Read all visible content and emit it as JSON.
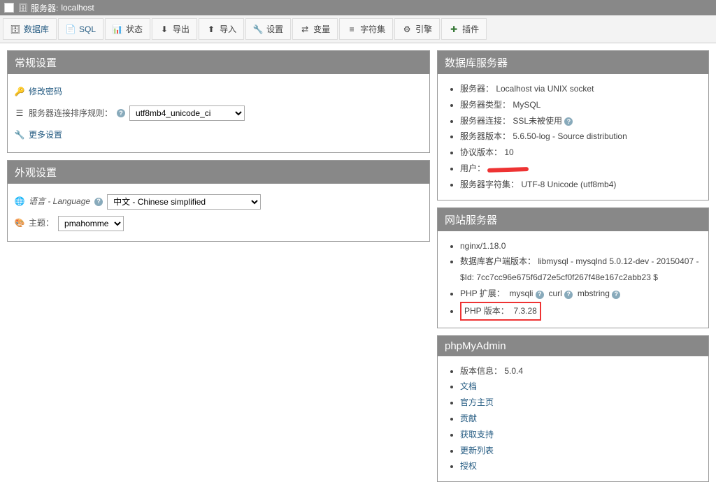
{
  "topbar": {
    "server_prefix": "服务器:",
    "server_name": "localhost"
  },
  "toolbar": {
    "items": [
      {
        "label": "数据库",
        "icon": "database-icon",
        "color": "#235a81"
      },
      {
        "label": "SQL",
        "icon": "sql-icon",
        "color": "#235a81"
      },
      {
        "label": "状态",
        "icon": "status-icon",
        "color": "#444"
      },
      {
        "label": "导出",
        "icon": "export-icon",
        "color": "#444"
      },
      {
        "label": "导入",
        "icon": "import-icon",
        "color": "#444"
      },
      {
        "label": "设置",
        "icon": "settings-icon",
        "color": "#444"
      },
      {
        "label": "变量",
        "icon": "variables-icon",
        "color": "#444"
      },
      {
        "label": "字符集",
        "icon": "charsets-icon",
        "color": "#444"
      },
      {
        "label": "引擎",
        "icon": "engines-icon",
        "color": "#444"
      },
      {
        "label": "插件",
        "icon": "plugins-icon",
        "color": "#444"
      }
    ]
  },
  "general": {
    "title": "常规设置",
    "change_password": "修改密码",
    "collation_label": "服务器连接排序规则：",
    "collation_value": "utf8mb4_unicode_ci",
    "more_settings": "更多设置"
  },
  "appearance": {
    "title": "外观设置",
    "language_label": "语言 - Language",
    "language_value": "中文 - Chinese simplified",
    "theme_label": "主题：",
    "theme_value": "pmahomme"
  },
  "db_server": {
    "title": "数据库服务器",
    "items": [
      "服务器：  Localhost via UNIX socket",
      "服务器类型：  MySQL",
      "服务器连接：  SSL未被使用",
      "服务器版本：  5.6.50-log - Source distribution",
      "协议版本：  10",
      "用户：",
      "服务器字符集：  UTF-8 Unicode (utf8mb4)"
    ]
  },
  "web_server": {
    "title": "网站服务器",
    "nginx": "nginx/1.18.0",
    "client_version": "数据库客户端版本：  libmysql - mysqlnd 5.0.12-dev - 20150407 - $Id: 7cc7cc96e675f6d72e5cf0f267f48e167c2abb23 $",
    "php_ext_label": "PHP 扩展：",
    "php_ext": [
      "mysqli",
      "curl",
      "mbstring"
    ],
    "php_version_label": "PHP 版本：",
    "php_version_value": "7.3.28"
  },
  "phpmyadmin": {
    "title": "phpMyAdmin",
    "version_label": "版本信息：",
    "version_value": "5.0.4",
    "links": [
      "文档",
      "官方主页",
      "贡献",
      "获取支持",
      "更新列表",
      "授权"
    ]
  }
}
